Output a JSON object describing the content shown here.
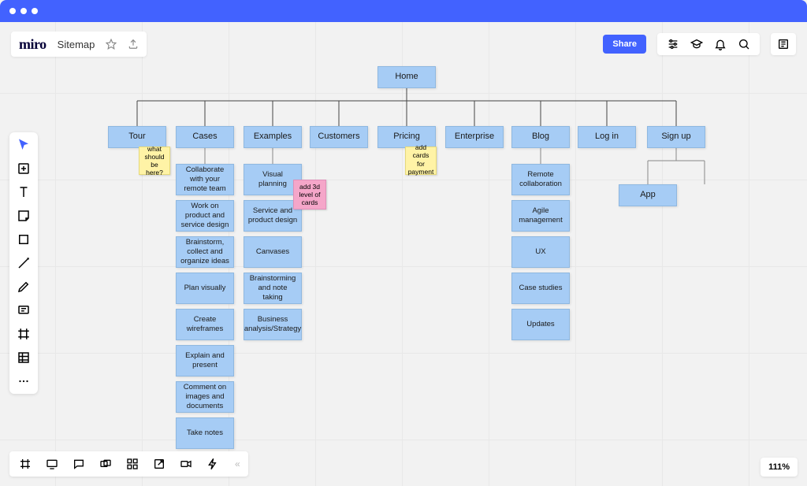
{
  "window": {
    "title": "Browser window"
  },
  "app": {
    "logo": "miro",
    "board_name": "Sitemap",
    "share_label": "Share",
    "zoom": "111%"
  },
  "sitemap": {
    "root": "Home",
    "categories": [
      {
        "label": "Tour"
      },
      {
        "label": "Cases"
      },
      {
        "label": "Examples"
      },
      {
        "label": "Customers"
      },
      {
        "label": "Pricing"
      },
      {
        "label": "Enterprise"
      },
      {
        "label": "Blog"
      },
      {
        "label": "Log in"
      },
      {
        "label": "Sign up"
      }
    ],
    "children": {
      "cases": [
        "Collaborate with your remote team",
        "Work on product and service design",
        "Brainstorm, collect and organize ideas",
        "Plan visually",
        "Create wireframes",
        "Explain and present",
        "Comment on images and documents",
        "Take notes"
      ],
      "examples": [
        "Visual planning",
        "Service and product design",
        "Canvases",
        "Brainstorming and note taking",
        "Business analysis/Strategy"
      ],
      "blog": [
        "Remote collaboration",
        "Agile management",
        "UX",
        "Case studies",
        "Updates"
      ],
      "signup": [
        "App"
      ]
    },
    "stickies": {
      "tour_note": "what should be here?",
      "examples_note": "add 3d level of cards",
      "pricing_note": "add cards for payment"
    }
  }
}
